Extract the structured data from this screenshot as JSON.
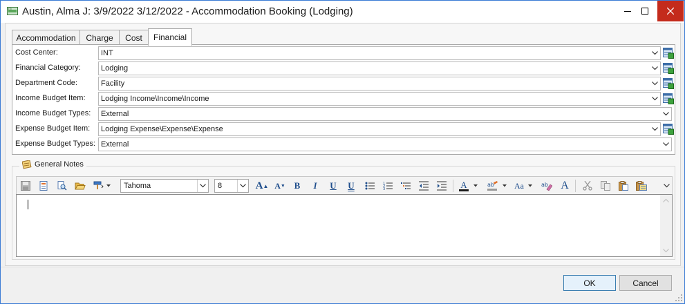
{
  "window": {
    "title": "Austin, Alma J:  3/9/2022 3/12/2022  - Accommodation Booking (Lodging)",
    "controls": {
      "minimize_icon": "minimize-icon",
      "maximize_icon": "maximize-icon",
      "close_icon": "close-icon"
    }
  },
  "tabs": [
    {
      "label": "Accommodation",
      "active": false
    },
    {
      "label": "Charge",
      "active": false
    },
    {
      "label": "Cost",
      "active": false
    },
    {
      "label": "Financial",
      "active": true
    }
  ],
  "financial": {
    "rows": [
      {
        "label": "Cost Center:",
        "value": "INT",
        "has_lookup": true
      },
      {
        "label": "Financial Category:",
        "value": "Lodging",
        "has_lookup": true
      },
      {
        "label": "Department Code:",
        "value": "Facility",
        "has_lookup": true
      },
      {
        "label": "Income Budget Item:",
        "value": "Lodging Income\\Income\\Income",
        "has_lookup": true
      },
      {
        "label": "Income Budget Types:",
        "value": "External",
        "has_lookup": false
      },
      {
        "label": "Expense Budget Item:",
        "value": "Lodging Expense\\Expense\\Expense",
        "has_lookup": true
      },
      {
        "label": "Expense Budget Types:",
        "value": "External",
        "has_lookup": false
      }
    ]
  },
  "notes": {
    "header": "General Notes",
    "font_name": "Tahoma",
    "font_size": "8",
    "text": ""
  },
  "buttons": {
    "ok": "OK",
    "cancel": "Cancel"
  },
  "colors": {
    "close_button": "#c42b1c",
    "ok_border": "#3c7fb1",
    "icon_blue": "#1f4e8c"
  }
}
